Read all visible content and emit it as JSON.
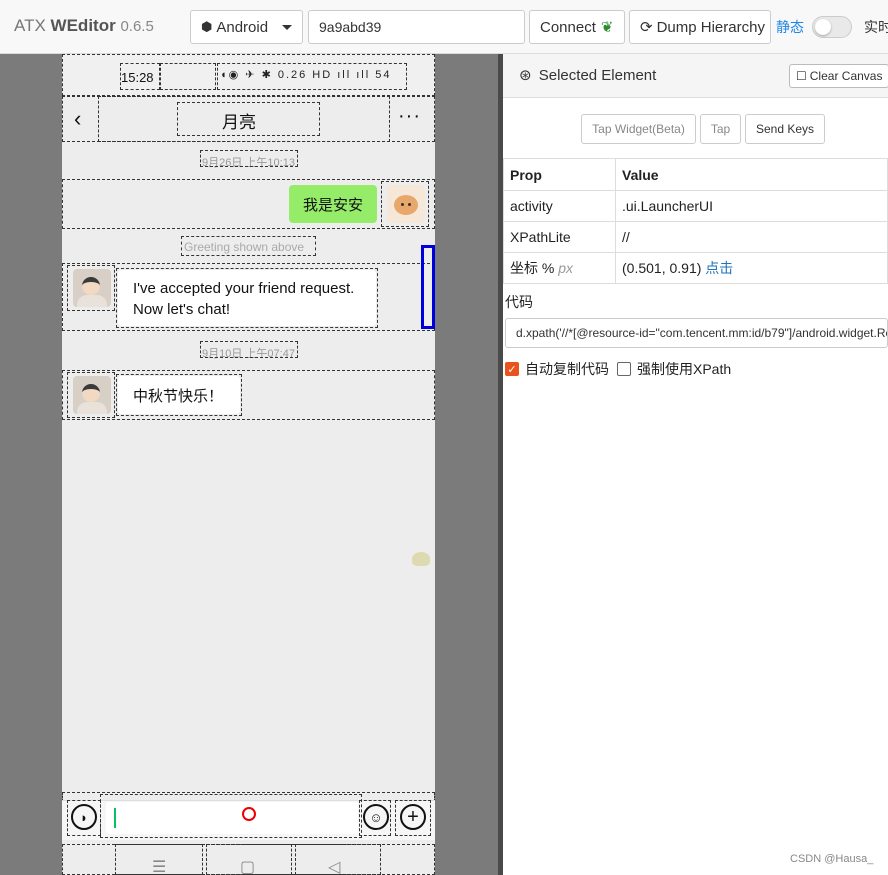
{
  "navbar": {
    "brand_prefix": "ATX",
    "brand_name": "WEditor",
    "version": "0.6.5",
    "platform": "Android",
    "serial": "9a9abd39",
    "connect_label": "Connect",
    "dump_label": "Dump Hierarchy",
    "mode_static": "静态",
    "mode_live": "实时"
  },
  "phone": {
    "status_time": "15:28",
    "status_icons": "◖◉ ✈ ✱ 0.26 HD ıll ıll 54",
    "chat_title": "月亮",
    "time1": "9月26日 上午10:13",
    "my_message": "我是安安",
    "greeting": "Greeting shown above",
    "msg1": "I've accepted your friend request. Now let's chat!",
    "time2": "9月10日 上午07:47",
    "msg2": "中秋节快乐！",
    "nav_menu": "☰",
    "nav_home": "▢",
    "nav_back": "◁"
  },
  "inspector": {
    "title": "Selected Element",
    "clear_label": "Clear Canvas",
    "tap_widget_label": "Tap Widget(Beta)",
    "tap_label": "Tap",
    "send_keys_label": "Send Keys",
    "col_prop": "Prop",
    "col_value": "Value",
    "rows": [
      {
        "prop": "activity",
        "value": ".ui.LauncherUI"
      },
      {
        "prop": "XPathLite",
        "value": "//"
      }
    ],
    "coord_label": "坐标 %",
    "coord_unit": "px",
    "coord_value": "(0.501, 0.91)",
    "coord_link": "点击",
    "code_label": "代码",
    "code_value": "d.xpath('//*[@resource-id=\"com.tencent.mm:id/b79\"]/android.widget.Re",
    "auto_copy_label": "自动复制代码",
    "force_xpath_label": "强制使用XPath"
  },
  "colors": {
    "accent": "#1e88e5",
    "bubble_green": "#95ec69",
    "checkbox_on": "#e8541e",
    "selection_box": "#0000dd"
  },
  "watermark": "CSDN @Hausa_"
}
